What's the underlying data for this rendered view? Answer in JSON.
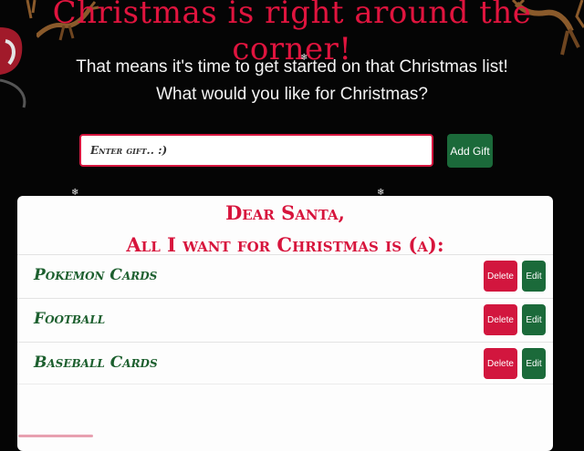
{
  "header": {
    "title": "Christmas is right around the corner!",
    "subtitle_line1": "That means it's time to get started on that Christmas list!",
    "subtitle_line2": "What would you like for Christmas?"
  },
  "form": {
    "placeholder": "Enter gift.. :)",
    "add_label": "Add Gift"
  },
  "list": {
    "greeting": "Dear Santa,",
    "heading": "All I want for Christmas is (a):",
    "delete_label": "Delete",
    "edit_label": "Edit",
    "items": [
      {
        "name": "Pokemon Cards"
      },
      {
        "name": "Football"
      },
      {
        "name": "Baseball Cards"
      }
    ]
  },
  "colors": {
    "background": "#050505",
    "title_red": "#e0143e",
    "green": "#1b6a3a",
    "delete_red": "#d2163e"
  },
  "decorations": [
    "reindeer-icon",
    "sleigh-icon",
    "snowflake-icon"
  ]
}
